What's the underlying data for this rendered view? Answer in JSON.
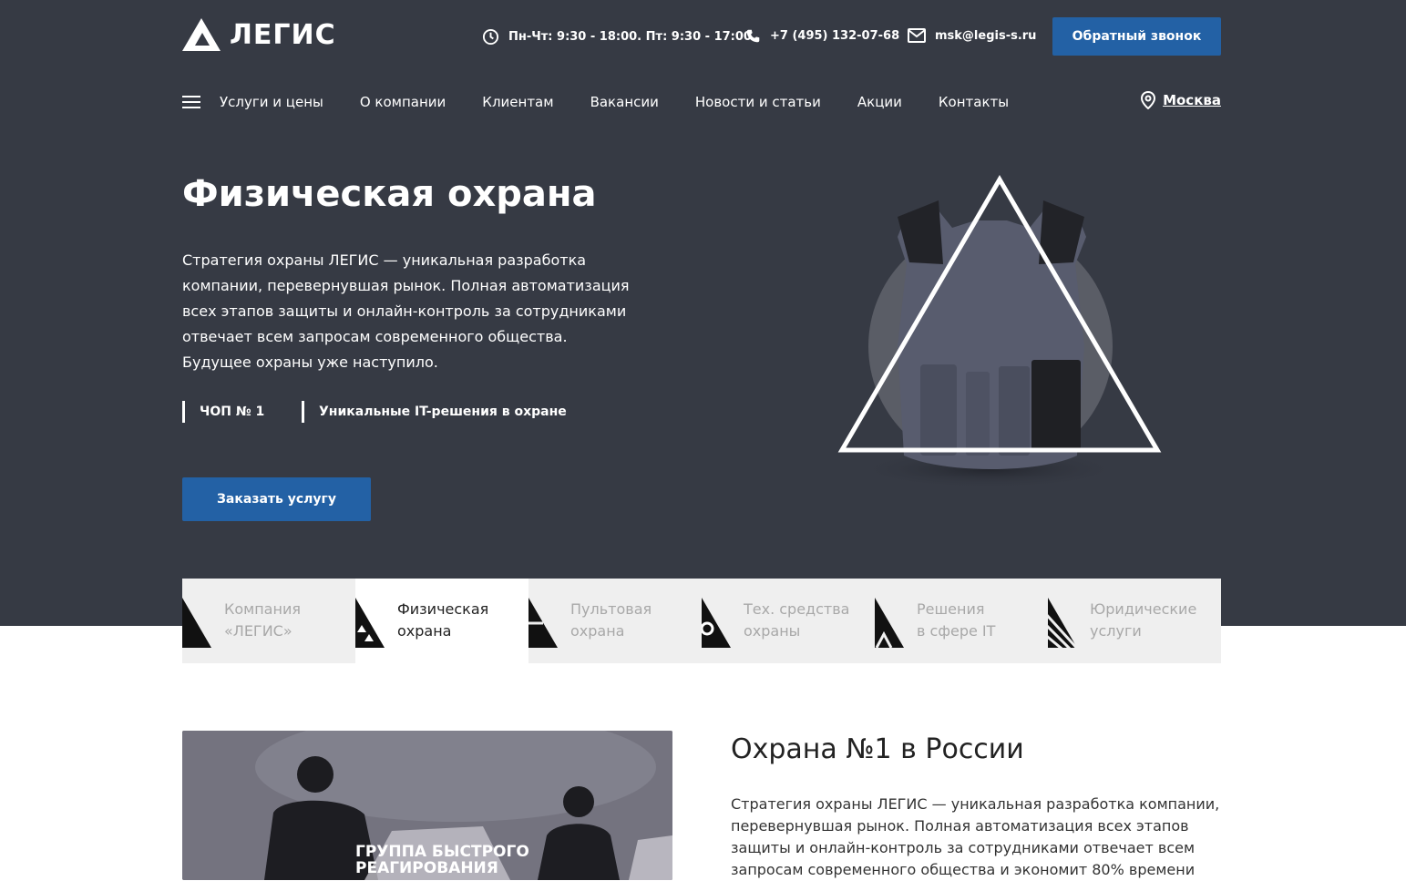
{
  "header": {
    "logo_text": "ЛЕГИС",
    "hours": "Пн-Чт: 9:30 - 18:00. Пт: 9:30 - 17:00.",
    "phone": "+7 (495) 132-07-68",
    "email": "msk@legis-s.ru",
    "callback_label": "Обратный звонок"
  },
  "nav": {
    "items": [
      "Услуги и цены",
      "О компании",
      "Клиентам",
      "Вакансии",
      "Новости и статьи",
      "Акции",
      "Контакты"
    ],
    "city": "Москва"
  },
  "hero": {
    "title": "Физическая охрана",
    "description": "Стратегия охраны ЛЕГИС — уникальная разработка компании, перевернувшая рынок. Полная автоматизация всех этапов защиты и онлайн-контроль за сотрудниками отвечает всем запросам современного общества. Будущее охраны уже наступило.",
    "tags": [
      "ЧОП № 1",
      "Уникальные IT-решения в охране"
    ],
    "cta_label": "Заказать услугу"
  },
  "tabs": [
    {
      "label": "Компания\n«ЛЕГИС»"
    },
    {
      "label": "Физическая\nохрана"
    },
    {
      "label": "Пультовая\nохрана"
    },
    {
      "label": "Тех. средства\nохраны"
    },
    {
      "label": "Решения\nв сфере IT"
    },
    {
      "label": "Юридические\nуслуги"
    }
  ],
  "active_tab": 1,
  "section": {
    "photo_caption": "Группа быстрого\nреагирования",
    "title": "Охрана №1 в России",
    "text": "Стратегия охраны ЛЕГИС — уникальная разработка компании, перевернувшая рынок. Полная автоматизация всех этапов защиты и онлайн-контроль за сотрудниками отвечает всем запросам современного общества и экономит 80% времени"
  },
  "colors": {
    "hero_bg": "#363a44",
    "accent": "#2361a5"
  }
}
